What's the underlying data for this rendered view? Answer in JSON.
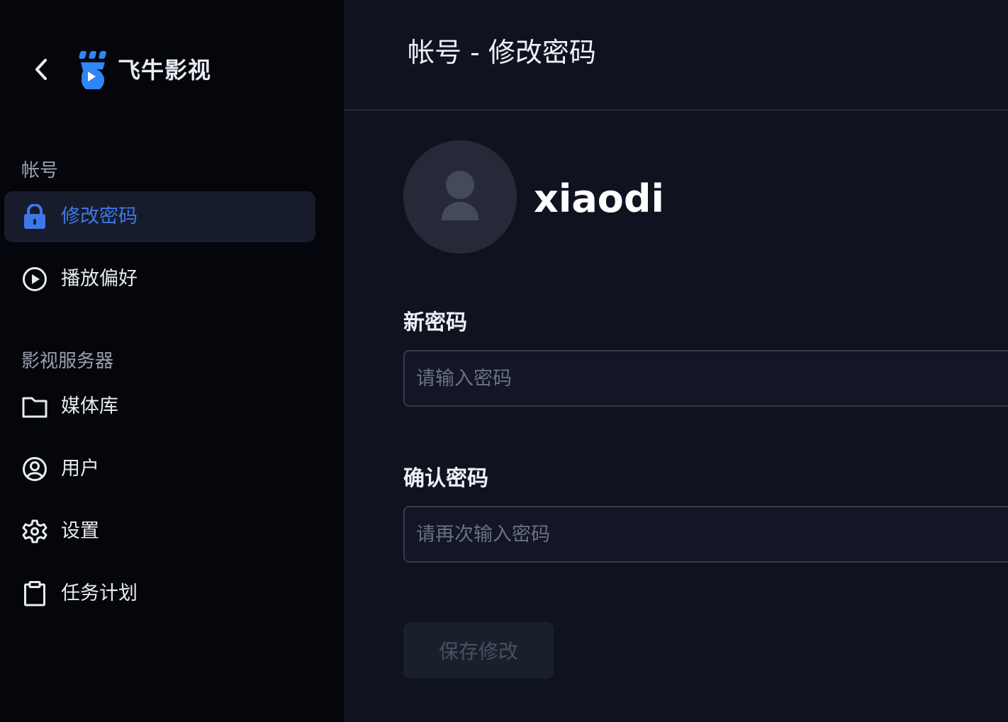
{
  "sidebar": {
    "back_icon": "chevron-left-icon",
    "logo": {
      "icon": "feiniu-logo-icon",
      "text": "飞牛影视"
    },
    "sections": [
      {
        "title": "帐号",
        "items": [
          {
            "label": "修改密码",
            "icon": "lock-icon",
            "active": true
          },
          {
            "label": "播放偏好",
            "icon": "play-circle-icon",
            "active": false
          }
        ]
      },
      {
        "title": "影视服务器",
        "items": [
          {
            "label": "媒体库",
            "icon": "folder-icon",
            "active": false
          },
          {
            "label": "用户",
            "icon": "user-circle-icon",
            "active": false
          },
          {
            "label": "设置",
            "icon": "gear-icon",
            "active": false
          },
          {
            "label": "任务计划",
            "icon": "clipboard-icon",
            "active": false
          }
        ]
      }
    ]
  },
  "main": {
    "title": "帐号 - 修改密码",
    "user": {
      "avatar_icon": "user-avatar-icon",
      "name": "xiaodi"
    },
    "new_password": {
      "label": "新密码",
      "placeholder": "请输入密码",
      "value": ""
    },
    "confirm_password": {
      "label": "确认密码",
      "placeholder": "请再次输入密码",
      "value": ""
    },
    "save_label": "保存修改"
  },
  "colors": {
    "accent": "#3e78e8",
    "sidebar_bg": "#05060b",
    "main_bg": "#0f1320",
    "active_item_bg": "#171c2c"
  }
}
